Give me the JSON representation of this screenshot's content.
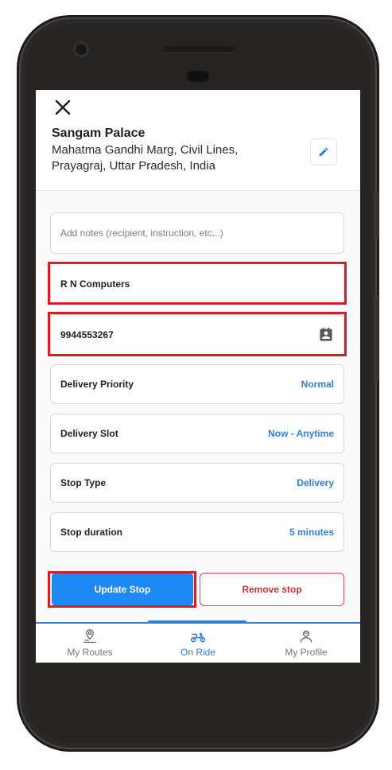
{
  "place": {
    "name": "Sangam Palace",
    "address": "Mahatma Gandhi Marg, Civil Lines, Prayagraj, Uttar Pradesh, India"
  },
  "form": {
    "notes_placeholder": "Add notes (recipient, instruction, etc...)",
    "recipient_name": "R N Computers",
    "phone": "9944553267",
    "rows": [
      {
        "label": "Delivery Priority",
        "value": "Normal"
      },
      {
        "label": "Delivery Slot",
        "value": "Now - Anytime"
      },
      {
        "label": "Stop Type",
        "value": "Delivery"
      },
      {
        "label": "Stop duration",
        "value": "5 minutes"
      }
    ]
  },
  "actions": {
    "update_label": "Update Stop",
    "remove_label": "Remove stop"
  },
  "tabs": [
    {
      "label": "My Routes",
      "icon": "route-pin-icon"
    },
    {
      "label": "On Ride",
      "icon": "scooter-icon"
    },
    {
      "label": "My Profile",
      "icon": "profile-icon"
    }
  ],
  "colors": {
    "accent": "#2f7ed8",
    "primary_button": "#1e88f5",
    "danger": "#c9313d",
    "highlight": "#d21f2a"
  }
}
